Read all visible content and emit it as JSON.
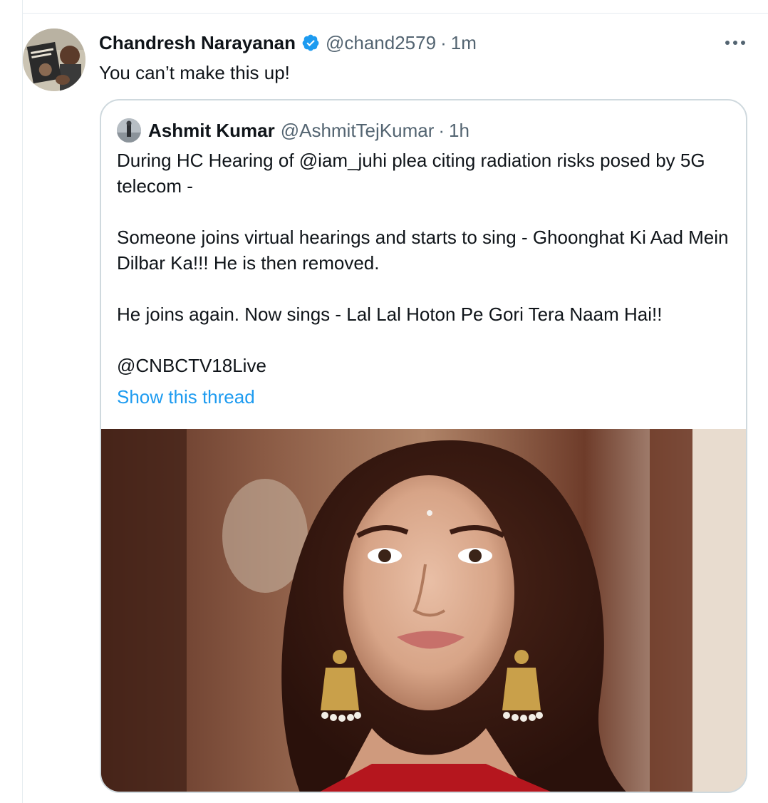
{
  "tweet": {
    "author_name": "Chandresh Narayanan",
    "author_handle": "@chand2579",
    "separator": "·",
    "time": "1m",
    "text": "You can’t make this up!"
  },
  "quoted_tweet": {
    "author_name": "Ashmit Kumar",
    "author_handle": "@AshmitTejKumar",
    "separator": "·",
    "time": "1h",
    "text": "During HC Hearing of @iam_juhi plea citing radiation risks posed by 5G telecom -\n\nSomeone joins virtual hearings and starts to sing - Ghoonghat Ki Aad Mein Dilbar Ka!!! He is then removed.\n\nHe joins again. Now sings - Lal Lal Hoton Pe Gori Tera Naam Hai!!\n\n@CNBCTV18Live",
    "show_thread_label": "Show this thread"
  },
  "colors": {
    "text_primary": "#0f1419",
    "text_secondary": "#536471",
    "link": "#1d9bf0",
    "verified": "#1d9bf0",
    "border": "#cfd9de"
  },
  "icons": {
    "verified": "verified-badge-icon",
    "more": "more-options-icon"
  }
}
